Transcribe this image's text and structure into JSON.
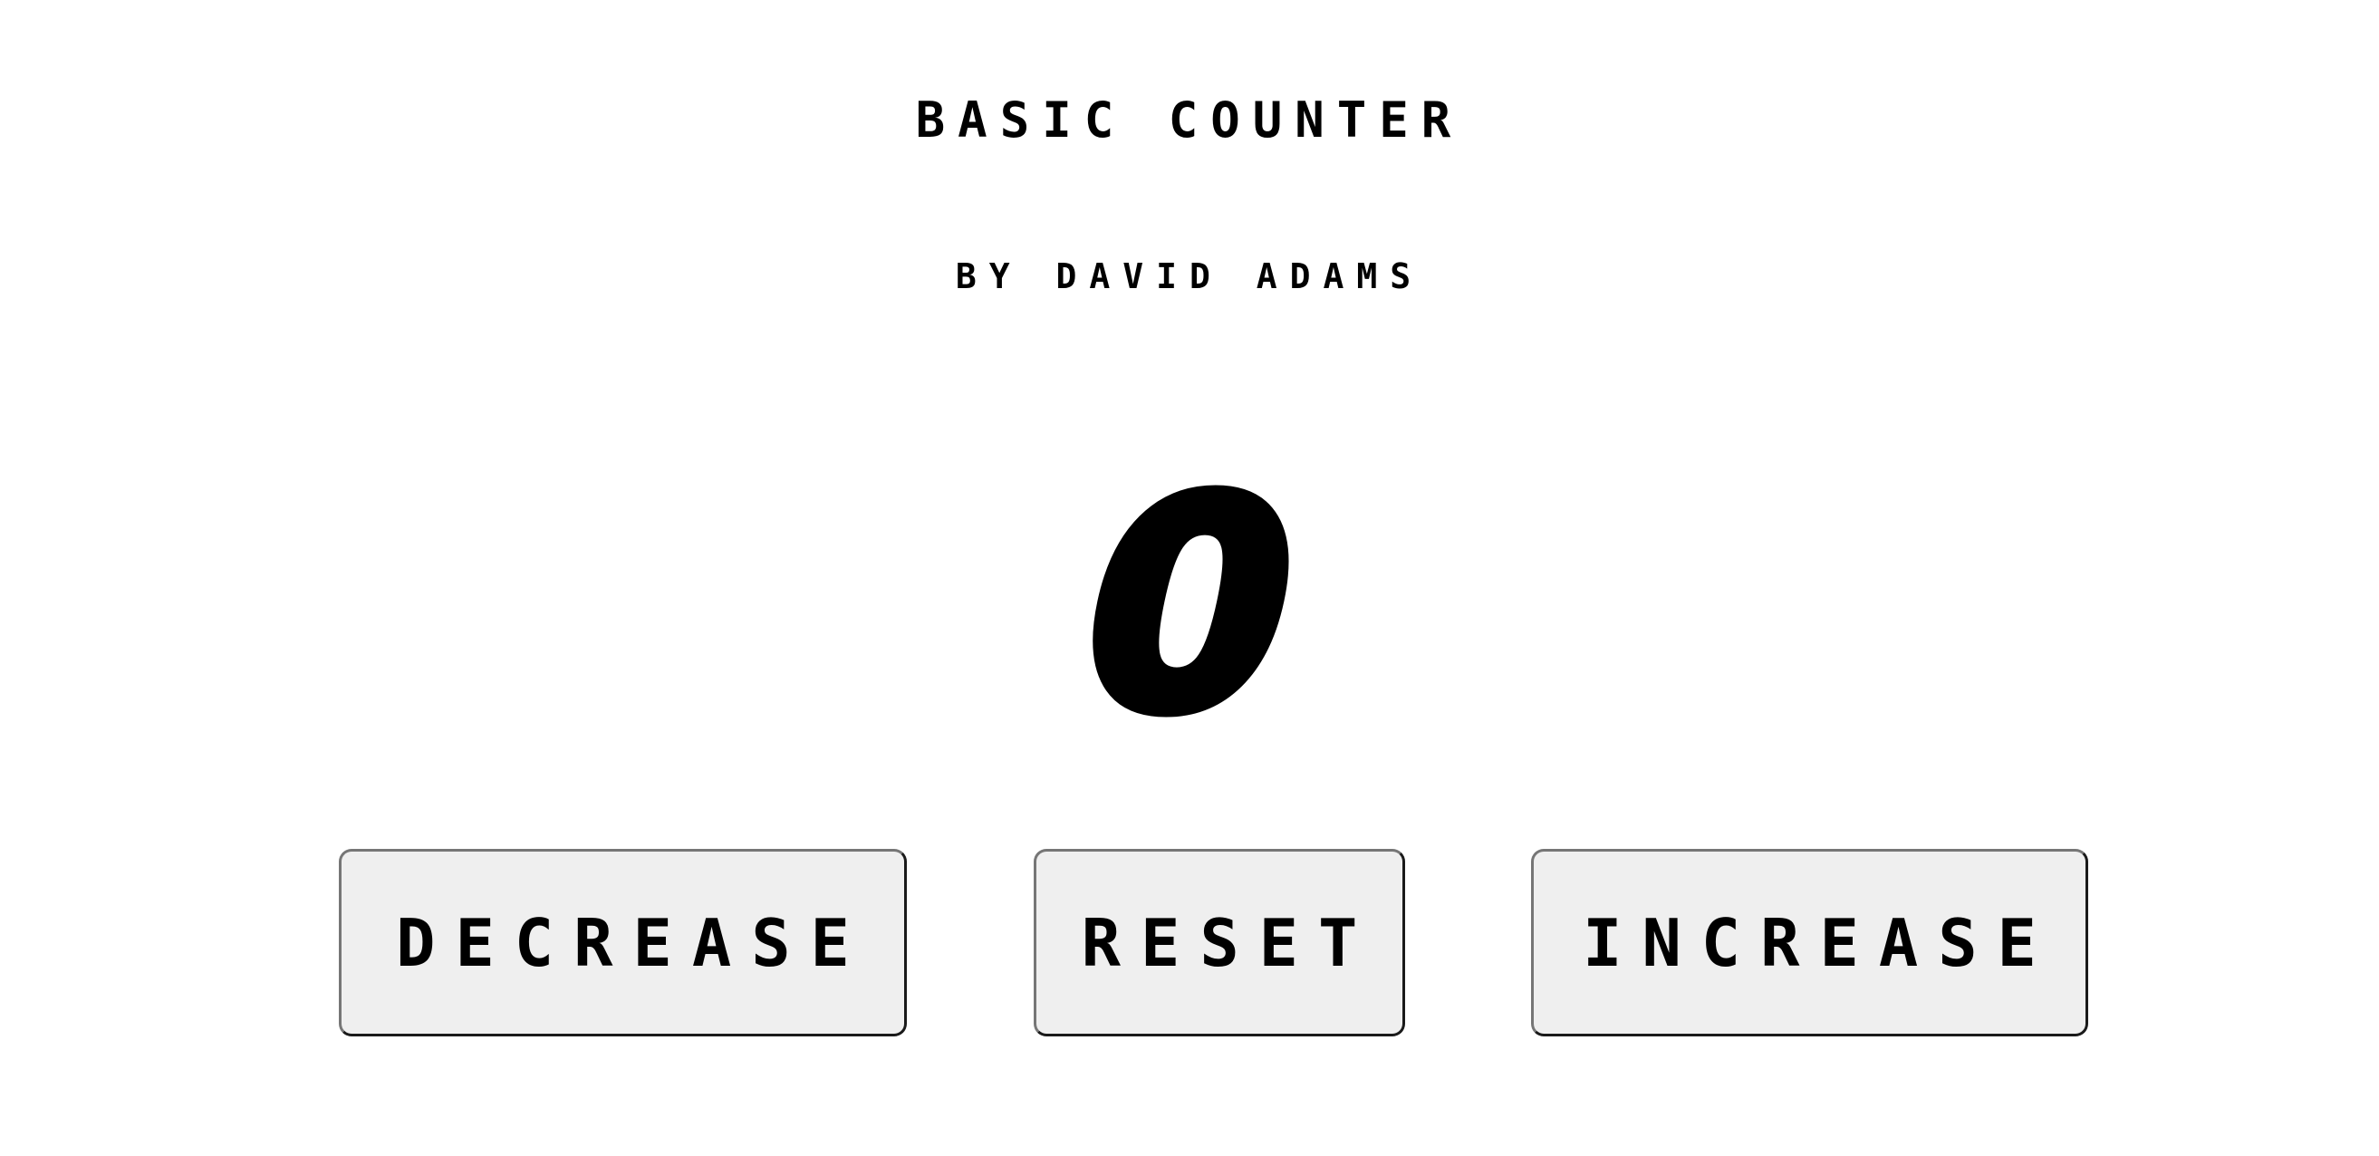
{
  "header": {
    "title": "BASIC COUNTER",
    "subtitle": "BY DAVID ADAMS"
  },
  "counter": {
    "value": "0"
  },
  "controls": {
    "decrease_label": "DECREASE",
    "reset_label": "RESET",
    "increase_label": "INCREASE"
  },
  "colors": {
    "background": "#ffffff",
    "text": "#000000",
    "button_background": "#efefef"
  }
}
